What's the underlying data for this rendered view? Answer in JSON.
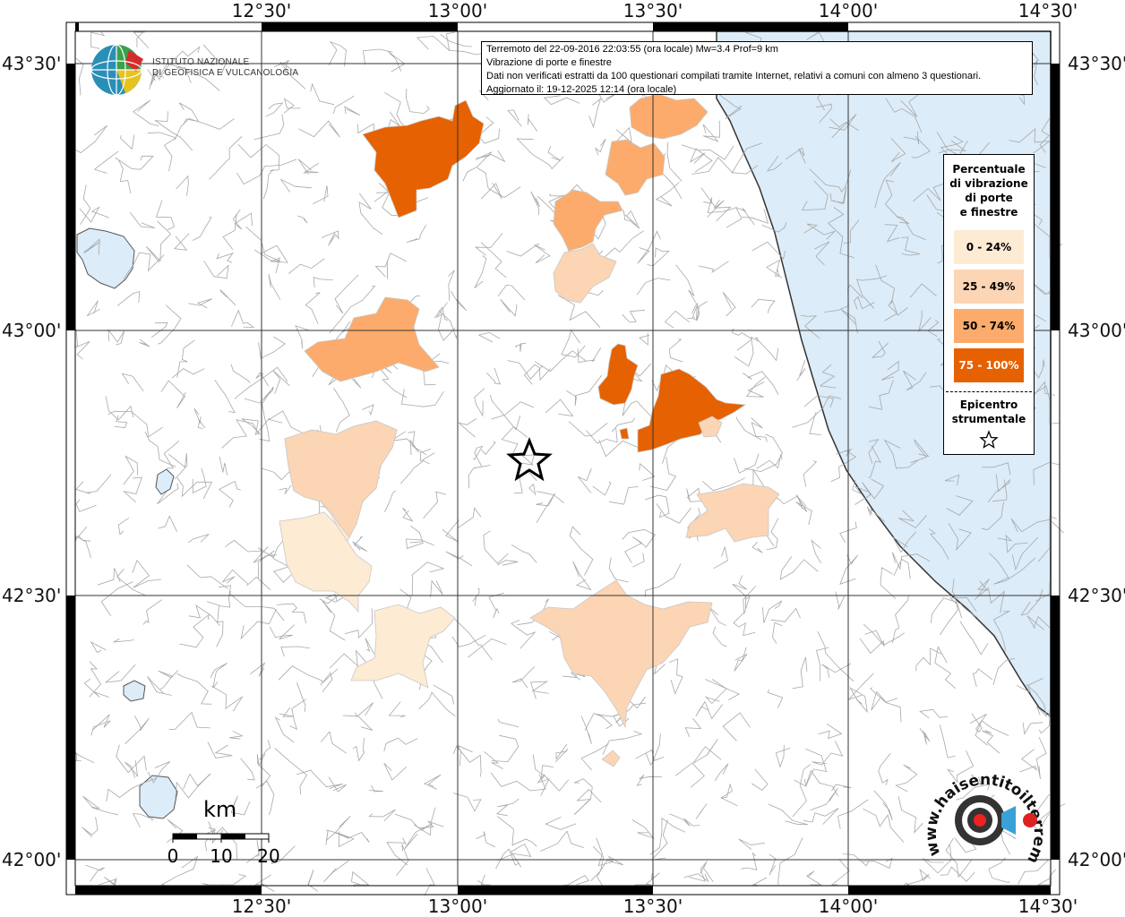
{
  "map": {
    "info": {
      "line1": "Terremoto del 22-09-2016 22:03:55 (ora locale) Mw=3.4 Prof=9 km",
      "line2": "Vibrazione di porte e finestre",
      "line3": "Dati non verificati estratti da 100 questionari compilati tramite Internet, relativi a comuni con almeno 3 questionari.",
      "line4": "Aggiornato il: 19-12-2025 12:14 (ora locale)"
    },
    "lon_labels": [
      "12°30'",
      "13°00'",
      "13°30'",
      "14°00'",
      "14°30'"
    ],
    "lat_labels": [
      "43°30'",
      "43°00'",
      "42°30'",
      "42°00'"
    ],
    "logo": {
      "line1": "ISTITUTO NAZIONALE",
      "line2": "DI GEOFISICA E VULCANOLOGIA",
      "icon": "ingv-globe-logo"
    },
    "legend": {
      "title": "Percentuale di vibrazione di porte e finestre",
      "title_lines": [
        "Percentuale",
        "di vibrazione",
        "di porte",
        "e finestre"
      ],
      "classes": [
        {
          "label": "0 - 24%",
          "color": "#fdebd4"
        },
        {
          "label": "25 - 49%",
          "color": "#fcd5b4"
        },
        {
          "label": "50 - 74%",
          "color": "#fcab6c"
        },
        {
          "label": "75 - 100%",
          "color": "#e66101"
        }
      ],
      "epicenter_lines": [
        "Epicentro",
        "strumentale"
      ],
      "epicenter_icon": "star-icon"
    },
    "scale": {
      "unit": "km",
      "ticks": [
        "0",
        "10",
        "20"
      ]
    },
    "watermark": {
      "text": "www.haisentitoilterremoto.it",
      "icon": "haisentitoilterremoto-logo"
    },
    "colors": {
      "sea": "#dcecf8",
      "border": "#9a9a9a",
      "grid": "#333333"
    }
  }
}
